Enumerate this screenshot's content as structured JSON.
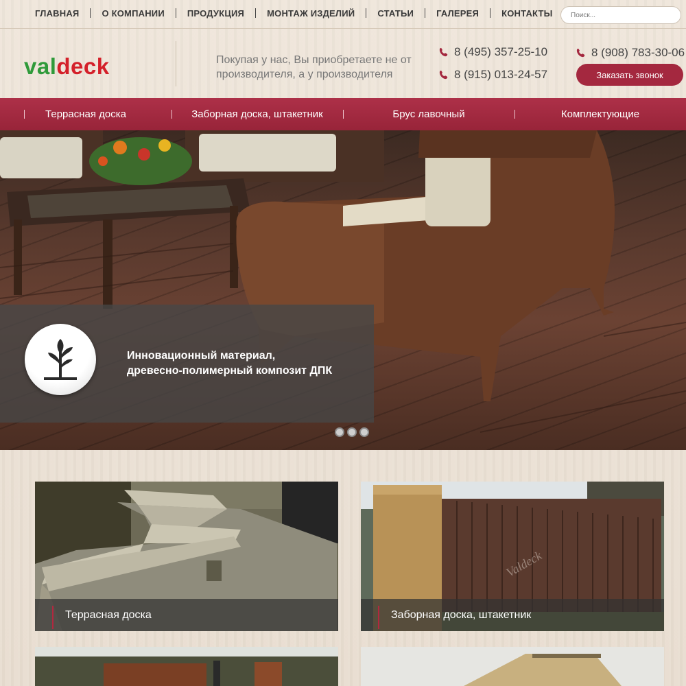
{
  "nav": {
    "items": [
      "ГЛАВНАЯ",
      "О КОМПАНИИ",
      "ПРОДУКЦИЯ",
      "МОНТАЖ ИЗДЕЛИЙ",
      "СТАТЬИ",
      "ГАЛЕРЕЯ",
      "КОНТАКТЫ"
    ],
    "search_placeholder": "Поиск..."
  },
  "header": {
    "logo_part1": "val",
    "logo_part2": "deck",
    "tagline": "Покупая у нас, Вы приобретаете не от производителя, а у производителя",
    "phones": [
      "8 (495) 357-25-10",
      "8 (915) 013-24-57",
      "8 (908) 783-30-06"
    ],
    "callback_label": "Заказать звонок"
  },
  "categories": [
    "Террасная доска",
    "Заборная доска, штакетник",
    "Брус лавочный",
    "Комплектующие"
  ],
  "hero": {
    "caption_line1": "Инновационный материал,",
    "caption_line2": "древесно-полимерный композит ДПК",
    "slides": 3,
    "active_slide": 1
  },
  "tiles": [
    {
      "label": "Террасная доска"
    },
    {
      "label": "Заборная доска, штакетник"
    },
    {
      "label": ""
    },
    {
      "label": ""
    }
  ],
  "watermark": "Valdeck",
  "colors": {
    "accent": "#a4283f",
    "logo_green": "#2f9a3a",
    "logo_red": "#d4202a",
    "background": "#ece2d6"
  },
  "icons": {
    "phone": "phone-icon",
    "badge": "tree-icon"
  }
}
